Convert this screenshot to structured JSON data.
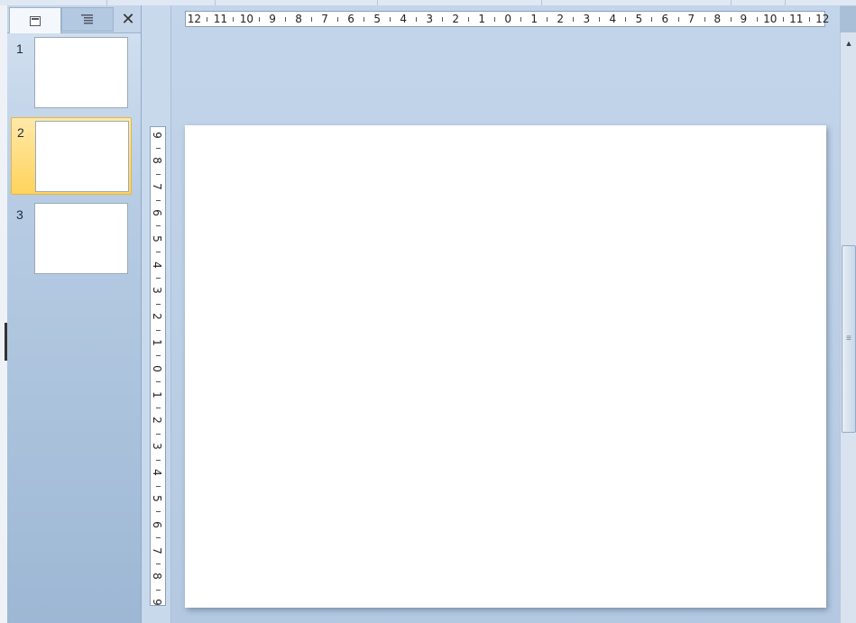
{
  "thumbnails_pane": {
    "tabs": [
      {
        "name": "Slides",
        "icon": "slide-tab-icon"
      },
      {
        "name": "Outline",
        "icon": "outline-tab-icon"
      }
    ],
    "close_glyph": "✕"
  },
  "slides": [
    {
      "number": "1",
      "selected": false
    },
    {
      "number": "2",
      "selected": true
    },
    {
      "number": "3",
      "selected": false
    }
  ],
  "horizontal_ruler": {
    "labels": [
      "12",
      "11",
      "10",
      "9",
      "8",
      "7",
      "6",
      "5",
      "4",
      "3",
      "2",
      "1",
      "0",
      "1",
      "2",
      "3",
      "4",
      "5",
      "6",
      "7",
      "8",
      "9",
      "10",
      "11",
      "12"
    ]
  },
  "vertical_ruler": {
    "labels": [
      "9",
      "8",
      "7",
      "6",
      "5",
      "4",
      "3",
      "2",
      "1",
      "0",
      "1",
      "2",
      "3",
      "4",
      "5",
      "6",
      "7",
      "8",
      "9"
    ]
  },
  "colors": {
    "selected_slide": "#ffd35c",
    "pane_background": "#b8cde4",
    "slide_background": "#ffffff"
  }
}
